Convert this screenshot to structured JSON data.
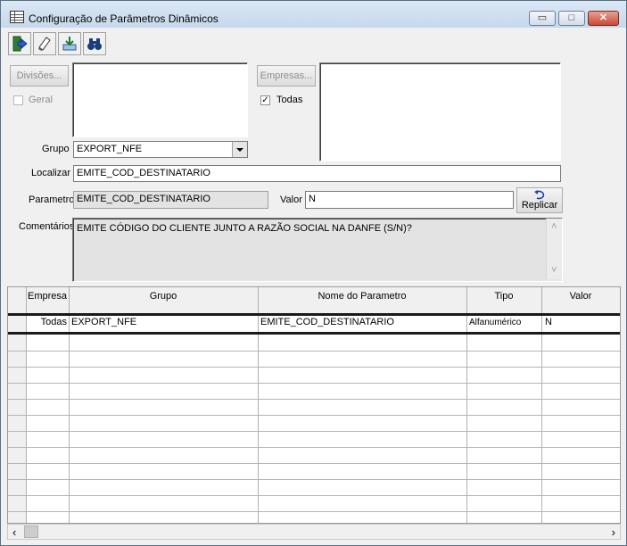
{
  "window": {
    "title": "Configuração de Parâmetros Dinâmicos"
  },
  "window_controls": {
    "minimize": "▭",
    "maximize": "□",
    "close": "✕"
  },
  "toolbar": {
    "icons": [
      "exit-icon",
      "eraser-icon",
      "save-icon",
      "binoculars-icon"
    ]
  },
  "form": {
    "divisoes_button": "Divisões...",
    "geral_label": "Geral",
    "geral_checked": false,
    "empresas_button": "Empresas...",
    "todas_label": "Todas",
    "todas_checked": true,
    "todas_mark": "✓",
    "grupo_label": "Grupo",
    "grupo_value": "EXPORT_NFE",
    "localizar_label": "Localizar",
    "localizar_value": "EMITE_COD_DESTINATARIO",
    "parametro_label": "Parametro",
    "parametro_value": "EMITE_COD_DESTINATARIO",
    "valor_label": "Valor",
    "valor_value": "N",
    "replicar_button": "Replicar",
    "comentarios_label": "Comentários",
    "comentarios_value": "EMITE CÓDIGO DO CLIENTE JUNTO A RAZÃO SOCIAL NA DANFE (S/N)?"
  },
  "grid": {
    "headers": [
      "Empresa",
      "Grupo",
      "Nome do Parametro",
      "Tipo",
      "Valor"
    ],
    "rows": [
      {
        "empresa": "Todas",
        "grupo": "EXPORT_NFE",
        "nome": "EMITE_COD_DESTINATARIO",
        "tipo": "Alfanumérico",
        "valor": "N"
      }
    ]
  },
  "scroll": {
    "up": "˄",
    "down": "˅",
    "left": "‹",
    "right": "›"
  }
}
